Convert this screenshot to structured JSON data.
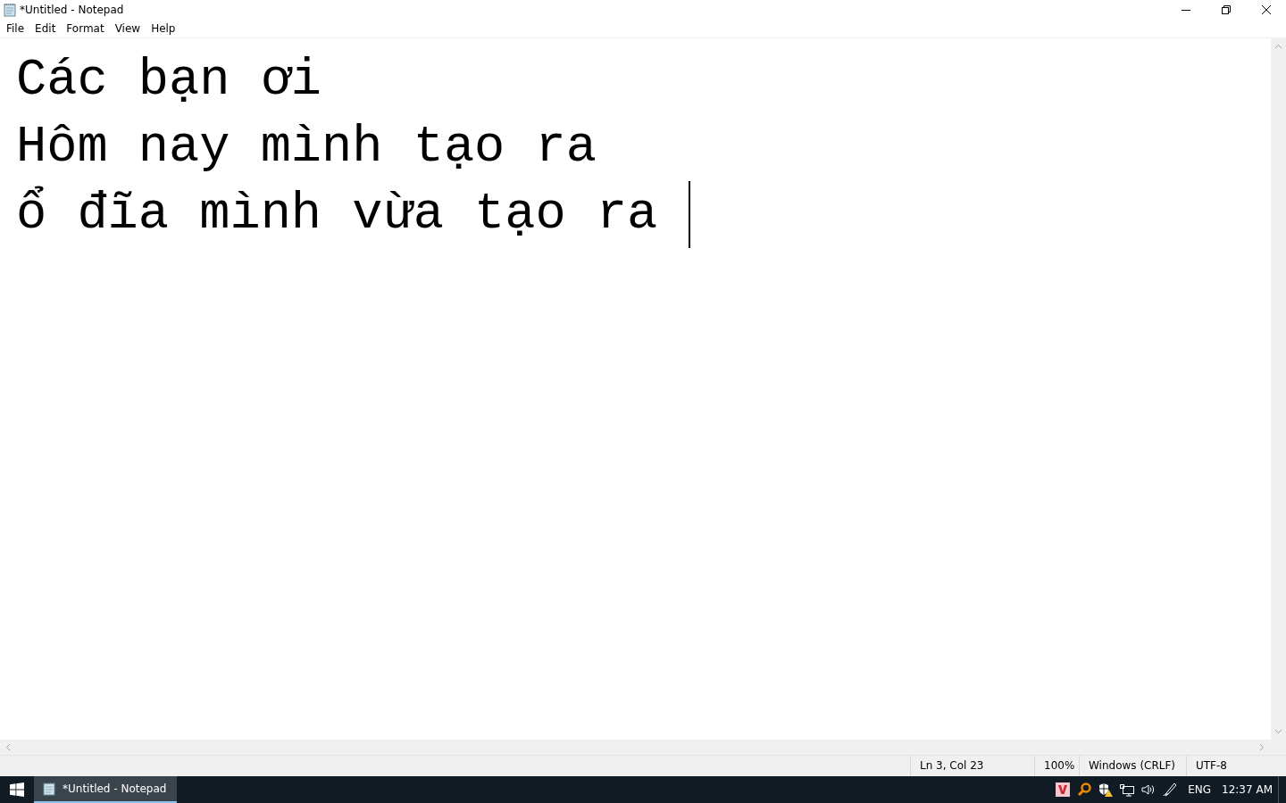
{
  "window": {
    "title": "*Untitled - Notepad"
  },
  "menu": [
    "File",
    "Edit",
    "Format",
    "View",
    "Help"
  ],
  "editor": {
    "lines": [
      "Các bạn ơi",
      "Hôm nay mình tạo ra",
      "ổ đĩa mình vừa tạo ra "
    ]
  },
  "status_bar": [
    "Ln 3, Col 23",
    "100%",
    "Windows (CRLF)",
    "UTF-8"
  ],
  "taskbar": {
    "apps": [
      {
        "label": "*Untitled - Notepad",
        "selected": true
      }
    ],
    "language": "ENG",
    "time": "12:37 AM"
  }
}
